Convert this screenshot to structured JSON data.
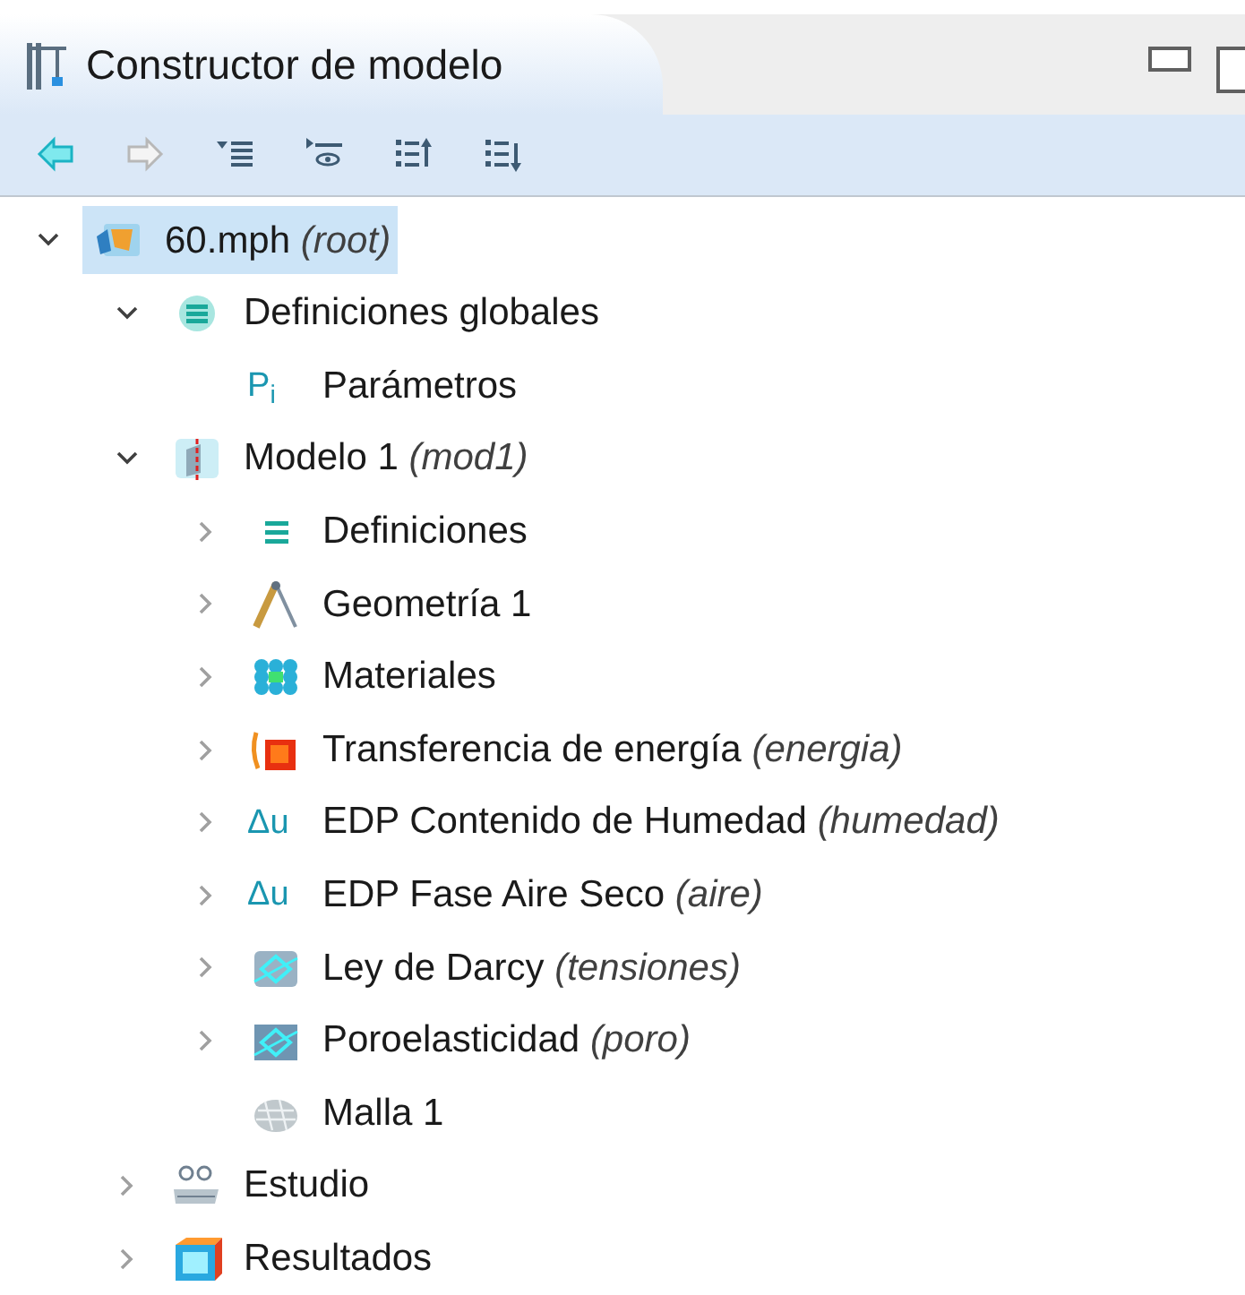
{
  "panel": {
    "title": "Constructor de modelo"
  },
  "toolbar": [
    {
      "kind": "back",
      "disabled": false
    },
    {
      "kind": "forward",
      "disabled": true
    },
    {
      "kind": "expand-list",
      "disabled": false
    },
    {
      "kind": "show-list",
      "disabled": false
    },
    {
      "kind": "move-up",
      "disabled": false
    },
    {
      "kind": "move-down",
      "disabled": false
    }
  ],
  "tree": [
    {
      "label": "60.mph",
      "note": "(root)",
      "kind": "file",
      "expanded": true,
      "selected": true,
      "children": [
        {
          "label": "Definiciones globales",
          "kind": "global-defs",
          "expanded": true,
          "selected": false,
          "children": [
            {
              "label": "Parámetros",
              "kind": "symbol",
              "symbol": "P$_{i}$",
              "selected": false
            }
          ]
        },
        {
          "label": "Modelo 1",
          "note": "(mod1)",
          "kind": "model",
          "expanded": true,
          "selected": false,
          "children": [
            {
              "label": "Definiciones",
              "kind": "defs",
              "expanded": false,
              "selected": false
            },
            {
              "label": "Geometría 1",
              "kind": "geometry",
              "expanded": false,
              "selected": false
            },
            {
              "label": "Materiales",
              "kind": "materials",
              "expanded": false,
              "selected": false
            },
            {
              "label": "Transferencia de energía",
              "note": "(energia)",
              "kind": "heat",
              "expanded": false,
              "selected": false
            },
            {
              "label": "EDP Contenido de Humedad",
              "note": "(humedad)",
              "kind": "symbol",
              "symbol": "Δu",
              "expanded": false,
              "selected": false
            },
            {
              "label": "EDP Fase Aire Seco",
              "note": "(aire)",
              "kind": "symbol",
              "symbol": "Δu",
              "expanded": false,
              "selected": false
            },
            {
              "label": "Ley de Darcy",
              "note": "(tensiones)",
              "kind": "darcy",
              "expanded": false,
              "selected": false
            },
            {
              "label": "Poroelasticidad",
              "note": "(poro)",
              "kind": "poro",
              "expanded": false,
              "selected": false
            },
            {
              "label": "Malla 1",
              "kind": "mesh",
              "selected": false
            }
          ]
        },
        {
          "label": "Estudio",
          "kind": "study",
          "expanded": false,
          "selected": false
        },
        {
          "label": "Resultados",
          "kind": "results",
          "expanded": false,
          "selected": false
        }
      ]
    }
  ]
}
